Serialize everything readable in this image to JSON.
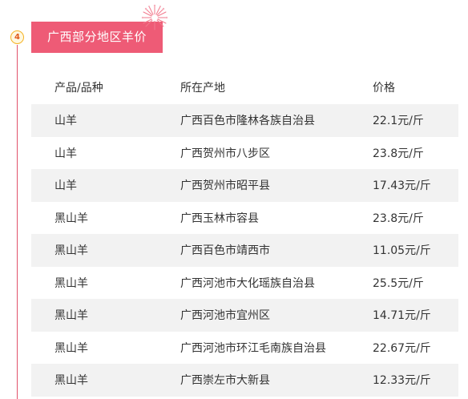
{
  "section": {
    "step_number": "4",
    "title": "广西部分地区羊价"
  },
  "table": {
    "headers": [
      "产品/品种",
      "所在产地",
      "价格"
    ],
    "rows": [
      [
        "山羊",
        "广西百色市隆林各族自治县",
        "22.1元/斤"
      ],
      [
        "山羊",
        "广西贺州市八步区",
        "23.8元/斤"
      ],
      [
        "山羊",
        "广西贺州市昭平县",
        "17.43元/斤"
      ],
      [
        "黑山羊",
        "广西玉林市容县",
        "23.8元/斤"
      ],
      [
        "黑山羊",
        "广西百色市靖西市",
        "11.05元/斤"
      ],
      [
        "黑山羊",
        "广西河池市大化瑶族自治县",
        "25.5元/斤"
      ],
      [
        "黑山羊",
        "广西河池市宜州区",
        "14.71元/斤"
      ],
      [
        "黑山羊",
        "广西河池市环江毛南族自治县",
        "22.67元/斤"
      ],
      [
        "黑山羊",
        "广西崇左市大新县",
        "12.33元/斤"
      ]
    ]
  },
  "colors": {
    "accent": "#ee5b76",
    "timeline": "#e2526b",
    "badge_border": "#f5b324",
    "row_shade": "#f2f2f2"
  },
  "icons": {
    "badge": "step-number-badge",
    "decoration": "firework-icon"
  }
}
